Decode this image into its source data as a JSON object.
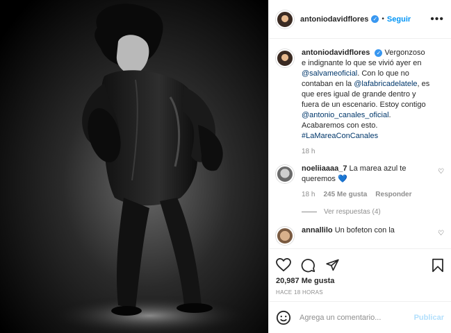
{
  "post": {
    "username": "antoniodavidflores",
    "follow_label": "Seguir",
    "dot": "•",
    "more": "•••"
  },
  "caption": {
    "username": "antoniodavidflores",
    "text_1": "Vergonzoso e indignante lo que se vivió ayer en ",
    "mention_1": "@salvameoficial",
    "text_2": ". Con lo que no contaban en la ",
    "mention_2": "@lafabricadelatele",
    "text_3": ", es que eres igual de grande dentro y fuera de un escenario. Estoy contigo ",
    "mention_3": "@antonio_canales_oficial",
    "text_4": ". Acabaremos con esto.",
    "hashtag": "#LaMareaConCanales",
    "time": "18 h"
  },
  "comments": [
    {
      "username": "noeliiaaaa_7",
      "text": "La marea azul te queremos",
      "emoji": "💙",
      "time": "18 h",
      "likes": "245 Me gusta",
      "reply": "Responder",
      "view_replies": "Ver respuestas (4)"
    },
    {
      "username": "annallilo",
      "text": "Un bofeton con la"
    }
  ],
  "actions": {
    "likes": "20,987 Me gusta",
    "time_ago": "HACE 18 HORAS"
  },
  "composer": {
    "placeholder": "Agrega un comentario...",
    "post_label": "Publicar"
  }
}
